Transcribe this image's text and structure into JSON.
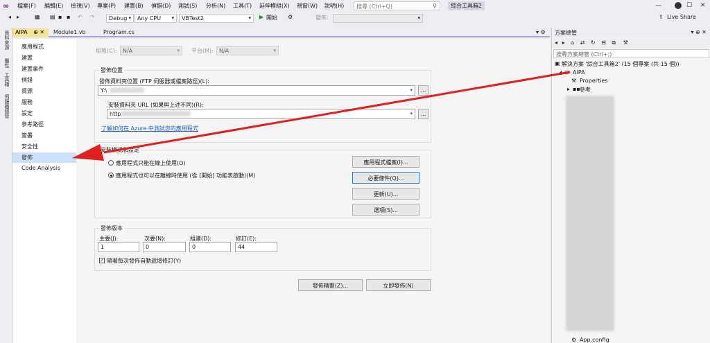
{
  "menu": [
    "檔案(F)",
    "編輯(E)",
    "檢視(V)",
    "專案(P)",
    "建置(B)",
    "偵錯(D)",
    "測試(S)",
    "分析(N)",
    "工具(T)",
    "延伸模組(X)",
    "視窗(W)",
    "說明(H)"
  ],
  "search": {
    "placeholder": "搜尋 (Ctrl+Q)"
  },
  "app_title": "綜合工具箱2",
  "live_share": "Live Share",
  "toolbar": {
    "config": "Debug",
    "platform": "Any CPU",
    "startup": "VBTest2",
    "start": "開始",
    "publish_label": "發佈:"
  },
  "left_rail": [
    "資料來源",
    "屬性",
    "工具箱",
    "伺服器總管"
  ],
  "tabs": [
    "AIPA",
    "Module1.vb",
    "Program.cs"
  ],
  "nav": [
    "應用程式",
    "建置",
    "建置事件",
    "偵錯",
    "資源",
    "服務",
    "設定",
    "參考路徑",
    "簽署",
    "安全性",
    "發佈",
    "Code Analysis"
  ],
  "config_row": {
    "config_label": "組態(C):",
    "config_value": "N/A",
    "platform_label": "平台(M):",
    "platform_value": "N/A"
  },
  "publish_location": {
    "heading": "發佈位置",
    "folder_label": "發佈資料夾位置 (FTP 伺服器或檔案路徑)(L):",
    "folder_value": "Y:\\",
    "url_label": "安裝資料夾 URL (如果與上述不同)(R):",
    "url_value": "http",
    "browse": "...",
    "azure_link": "了解如何在 Azure 中測試您的應用程式"
  },
  "install_mode": {
    "heading": "安裝模式和設定",
    "online_only": "應用程式只能在線上使用(O)",
    "offline": "應用程式也可以在離線時使用 (從 [開始] 功能表啟動)(M)",
    "files_btn": "應用程式檔案(I)...",
    "prereq_btn": "必要條件(Q)...",
    "updates_btn": "更新(U)...",
    "options_btn": "選項(S)..."
  },
  "publish_version": {
    "heading": "發佈版本",
    "major_label": "主要(J):",
    "major": "1",
    "minor_label": "次要(N):",
    "minor": "0",
    "build_label": "組建(D):",
    "build": "0",
    "revision_label": "修訂(E):",
    "revision": "44",
    "auto_increment": "隨著每次發佈自動遞增修訂(Y)"
  },
  "buttons": {
    "wizard": "發佈精靈(Z)...",
    "publish_now": "立即發佈(N)"
  },
  "solution": {
    "title": "方案總管",
    "search": "搜尋方案總管 (Ctrl+;)",
    "root": "解決方案 '綜合工具箱2' (15 個專案 (共 15 個))",
    "project": "AIPA",
    "properties": "Properties",
    "references": "參考",
    "last_item": "App.config"
  },
  "colors": {
    "accent": "#68217a",
    "selected_nav": "#cce0f7",
    "arrow": "#e02020",
    "active_tab": "#f5e39a"
  }
}
